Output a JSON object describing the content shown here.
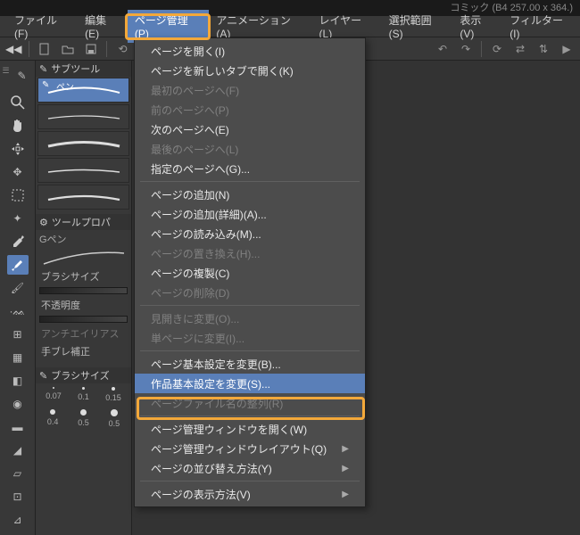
{
  "titlebar": "コミック  (B4 257.00 x 364.)",
  "menubar": [
    {
      "label": "ファイル(F)"
    },
    {
      "label": "編集(E)"
    },
    {
      "label": "ページ管理(P)",
      "active": true
    },
    {
      "label": "アニメーション(A)"
    },
    {
      "label": "レイヤー(L)"
    },
    {
      "label": "選択範囲(S)"
    },
    {
      "label": "表示(V)"
    },
    {
      "label": "フィルター(I)"
    }
  ],
  "toolbar_icons": [
    "new-doc-icon",
    "open-icon",
    "save-icon",
    "undo-icon",
    "redo-icon",
    "clear-icon",
    "undo2-icon",
    "redo2-icon",
    "rotate-icon",
    "fliph-icon",
    "flipv-icon",
    "playback-icon"
  ],
  "subtool": {
    "title": "サブツール",
    "items": [
      "ペン",
      "stroke-1",
      "stroke-2",
      "stroke-3",
      "stroke-4"
    ]
  },
  "toolprop": {
    "title": "ツールプロパ",
    "gpen": "Gペン",
    "props": [
      {
        "label": "ブラシサイズ",
        "dim": false
      },
      {
        "label": "不透明度",
        "dim": false
      },
      {
        "label": "アンチエイリアス",
        "dim": true
      },
      {
        "label": "手ブレ補正",
        "dim": false
      }
    ]
  },
  "brushsize": {
    "title": "ブラシサイズ",
    "row1": [
      "0.07",
      "0.1",
      "0.15"
    ],
    "row2": [
      "0.4",
      "0.5",
      "0.5"
    ]
  },
  "toolbox_icons": [
    "magnify-icon",
    "hand-icon",
    "move-icon",
    "marquee-icon",
    "transform-icon",
    "lasso-icon",
    "wand-icon",
    "eyedrop-icon",
    "pen-icon",
    "brush-icon",
    "airbrush-icon",
    "pattern-icon",
    "hatch-icon",
    "eraser-icon",
    "blend-icon",
    "fill-icon",
    "gradient-icon",
    "shape-icon",
    "frame-icon",
    "ruler-icon"
  ],
  "dropdown": {
    "groups": [
      [
        {
          "label": "ページを開く(I)"
        },
        {
          "label": "ページを新しいタブで開く(K)"
        },
        {
          "label": "最初のページへ(F)",
          "disabled": true
        },
        {
          "label": "前のページへ(P)",
          "disabled": true
        },
        {
          "label": "次のページへ(E)"
        },
        {
          "label": "最後のページへ(L)",
          "disabled": true
        },
        {
          "label": "指定のページへ(G)..."
        }
      ],
      [
        {
          "label": "ページの追加(N)"
        },
        {
          "label": "ページの追加(詳細)(A)..."
        },
        {
          "label": "ページの読み込み(M)..."
        },
        {
          "label": "ページの置き換え(H)...",
          "disabled": true
        },
        {
          "label": "ページの複製(C)"
        },
        {
          "label": "ページの削除(D)",
          "disabled": true
        }
      ],
      [
        {
          "label": "見開きに変更(O)...",
          "disabled": true
        },
        {
          "label": "単ページに変更(I)...",
          "disabled": true
        }
      ],
      [
        {
          "label": "ページ基本設定を変更(B)..."
        },
        {
          "label": "作品基本設定を変更(S)...",
          "hover": true
        },
        {
          "label": "ページファイル名の整列(R)",
          "disabled": true
        }
      ],
      [
        {
          "label": "ページ管理ウィンドウを開く(W)"
        },
        {
          "label": "ページ管理ウィンドウレイアウト(Q)",
          "sub": true
        },
        {
          "label": "ページの並び替え方法(Y)",
          "sub": true
        }
      ],
      [
        {
          "label": "ページの表示方法(V)",
          "sub": true
        }
      ]
    ]
  }
}
